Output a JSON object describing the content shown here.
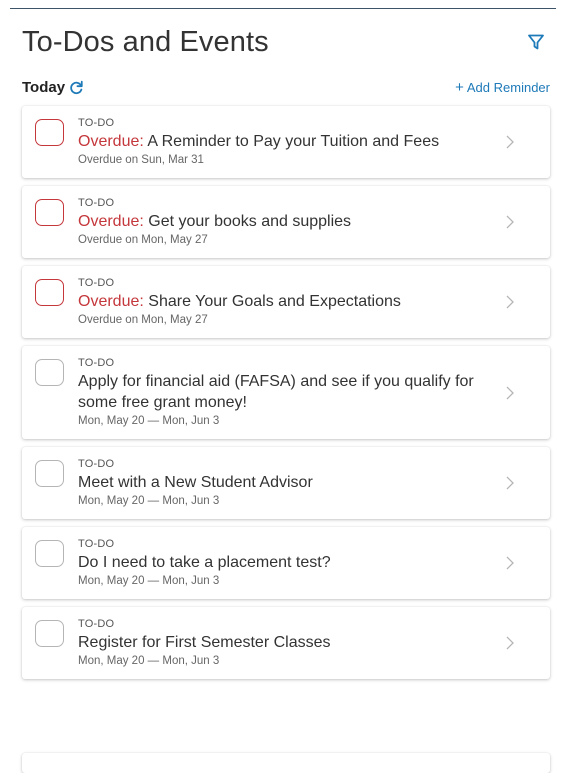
{
  "header": {
    "title": "To-Dos and Events",
    "filter_icon": "filter-icon"
  },
  "section": {
    "title": "Today",
    "refresh_icon": "refresh-icon",
    "add_label": "Add Reminder",
    "add_icon": "+"
  },
  "colors": {
    "accent": "#1e7ab8",
    "overdue": "#c4373b",
    "checkbox_border": "#b5b5b5"
  },
  "items": [
    {
      "type": "TO-DO",
      "overdue_prefix": "Overdue:",
      "title": "A Reminder to Pay your Tuition and Fees",
      "date": "Overdue on Sun, Mar 31"
    },
    {
      "type": "TO-DO",
      "overdue_prefix": "Overdue:",
      "title": "Get your books and supplies",
      "date": "Overdue on Mon, May 27"
    },
    {
      "type": "TO-DO",
      "overdue_prefix": "Overdue:",
      "title": "Share Your Goals and Expectations",
      "date": "Overdue on Mon, May 27"
    },
    {
      "type": "TO-DO",
      "overdue_prefix": "",
      "title": "Apply for financial aid (FAFSA) and see if you qualify for some free grant money!",
      "date": "Mon, May 20 — Mon, Jun 3"
    },
    {
      "type": "TO-DO",
      "overdue_prefix": "",
      "title": "Meet with a New Student Advisor",
      "date": "Mon, May 20 — Mon, Jun 3"
    },
    {
      "type": "TO-DO",
      "overdue_prefix": "",
      "title": "Do I need to take a placement test?",
      "date": "Mon, May 20 — Mon, Jun 3"
    },
    {
      "type": "TO-DO",
      "overdue_prefix": "",
      "title": "Register for First Semester Classes",
      "date": "Mon, May 20 — Mon, Jun 3"
    }
  ]
}
